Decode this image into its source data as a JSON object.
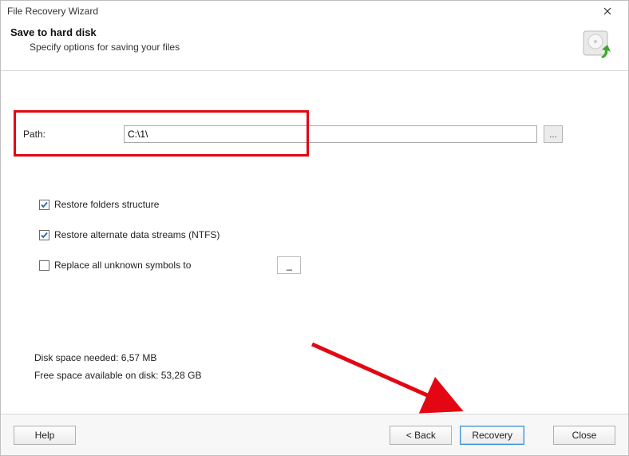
{
  "window": {
    "title": "File Recovery Wizard"
  },
  "header": {
    "heading": "Save to hard disk",
    "subtext": "Specify options for saving your files"
  },
  "path": {
    "label": "Path:",
    "value": "C:\\1\\",
    "browse_label": "..."
  },
  "options": {
    "restore_folders": {
      "label": "Restore folders structure",
      "checked": true
    },
    "restore_ads": {
      "label": "Restore alternate data streams (NTFS)",
      "checked": true
    },
    "replace_symbols": {
      "label": "Replace all unknown symbols to",
      "checked": false,
      "value": "_"
    }
  },
  "disk": {
    "needed": "Disk space needed: 6,57 MB",
    "free": "Free space available on disk: 53,28 GB"
  },
  "footer": {
    "help": "Help",
    "back": "< Back",
    "recovery": "Recovery",
    "close": "Close"
  }
}
